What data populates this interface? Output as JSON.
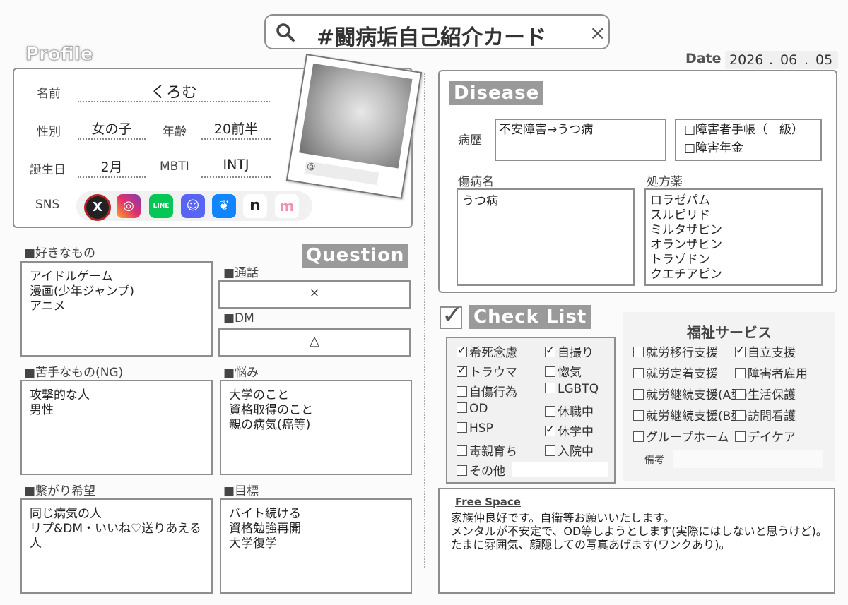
{
  "search": {
    "text": "#闘病垢自己紹介カード",
    "close": "×"
  },
  "date": {
    "label": "Date",
    "year": "2026",
    "month": "06",
    "day": "05",
    "sep": "."
  },
  "profile": {
    "badge": "Profile",
    "name_label": "名前",
    "name": "くろむ",
    "gender_label": "性別",
    "gender": "女の子",
    "age_label": "年齢",
    "age": "20前半",
    "birthday_label": "誕生日",
    "birthday": "2月",
    "mbti_label": "MBTI",
    "mbti": "INTJ",
    "sns_label": "SNS",
    "photo_caption": "@"
  },
  "question": {
    "badge": "Question",
    "call_label": "■通話",
    "call": "×",
    "dm_label": "■DM",
    "dm": "△"
  },
  "likes": {
    "label": "■好きなもの",
    "text": "アイドルゲーム\n漫画(少年ジャンプ)\nアニメ"
  },
  "dislikes": {
    "label": "■苦手なもの(NG)",
    "text": "攻撃的な人\n男性"
  },
  "worries": {
    "label": "■悩み",
    "text": "大学のこと\n資格取得のこと\n親の病気(癌等)"
  },
  "connect": {
    "label": "■繋がり希望",
    "text": "同じ病気の人\nリプ&DM・いいね♡送りあえる人"
  },
  "goals": {
    "label": "■目標",
    "text": "バイト続ける\n資格勉強再開\n大学復学"
  },
  "disease": {
    "badge": "Disease",
    "history_label": "病歴",
    "history": "不安障害→うつ病",
    "techo": "□障害者手帳（　級）",
    "nenkin": "□障害年金",
    "name_label": "傷病名",
    "name": "うつ病",
    "meds_label": "処方薬",
    "meds": "ロラゼパム\nスルピリド\nミルタザピン\nオランザピン\nトラゾドン\nクエチアピン"
  },
  "checklist": {
    "badge": "Check List",
    "items": [
      {
        "label": "希死念慮",
        "checked": true
      },
      {
        "label": "自撮り",
        "checked": true
      },
      {
        "label": "トラウマ",
        "checked": true
      },
      {
        "label": "惚気",
        "checked": false
      },
      {
        "label": "自傷行為",
        "checked": false
      },
      {
        "label": "LGBTQ",
        "checked": false
      },
      {
        "label": "OD",
        "checked": false
      },
      {
        "label": "休職中",
        "checked": false
      },
      {
        "label": "HSP",
        "checked": false
      },
      {
        "label": "休学中",
        "checked": true
      },
      {
        "label": "毒親育ち",
        "checked": false
      },
      {
        "label": "入院中",
        "checked": false
      },
      {
        "label": "その他",
        "checked": false
      }
    ]
  },
  "welfare": {
    "title": "福祉サービス",
    "items": [
      {
        "label": "就労移行支援",
        "checked": false
      },
      {
        "label": "自立支援",
        "checked": true
      },
      {
        "label": "就労定着支援",
        "checked": false
      },
      {
        "label": "障害者雇用",
        "checked": false
      },
      {
        "label": "就労継続支援(A型)",
        "checked": false
      },
      {
        "label": "生活保護",
        "checked": false
      },
      {
        "label": "就労継続支援(B型)",
        "checked": false
      },
      {
        "label": "訪問看護",
        "checked": false
      },
      {
        "label": "グループホーム",
        "checked": false
      },
      {
        "label": "デイケア",
        "checked": false
      }
    ],
    "note_label": "備考"
  },
  "free": {
    "label": "Free Space",
    "text": "家族仲良好です。自衛等お願いいたします。\nメンタルが不安定で、OD等しようとします(実際にはしないと思うけど)。\nたまに雰囲気、顔隠しての写真あげます(ワンクあり)。"
  },
  "colors": {
    "border": "#8e8e8e",
    "badge": "#9a9a9a",
    "x": "#222222",
    "instagram": "#e1306c",
    "line": "#06c755",
    "discord": "#5865f2",
    "bluesky": "#1185fe",
    "note": "#222222",
    "marshmallow": "#f48fb1"
  }
}
